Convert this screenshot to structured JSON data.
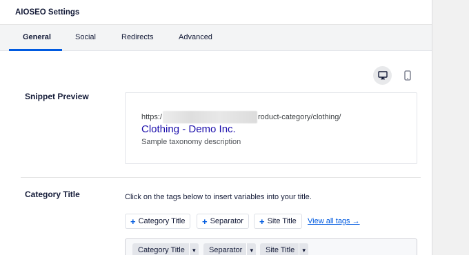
{
  "panel": {
    "title": "AIOSEO Settings"
  },
  "tabs": [
    {
      "label": "General",
      "active": true
    },
    {
      "label": "Social",
      "active": false
    },
    {
      "label": "Redirects",
      "active": false
    },
    {
      "label": "Advanced",
      "active": false
    }
  ],
  "preview_devices": [
    {
      "icon": "desktop-icon",
      "active": true
    },
    {
      "icon": "mobile-icon",
      "active": false
    }
  ],
  "snippet_preview": {
    "label": "Snippet Preview",
    "url_prefix": "https:/",
    "url_suffix": "roduct-category/clothing/",
    "title": "Clothing - Demo Inc.",
    "description": "Sample taxonomy description"
  },
  "category_title": {
    "label": "Category Title",
    "help_text": "Click on the tags below to insert variables into your title.",
    "tag_buttons": [
      "Category Title",
      "Separator",
      "Site Title"
    ],
    "view_all_link": "View all tags →",
    "editor_chips": [
      "Category Title",
      "Separator",
      "Site Title"
    ]
  },
  "colors": {
    "accent": "#005ae0",
    "snippet_title": "#1a0dab",
    "text": "#141b38"
  }
}
